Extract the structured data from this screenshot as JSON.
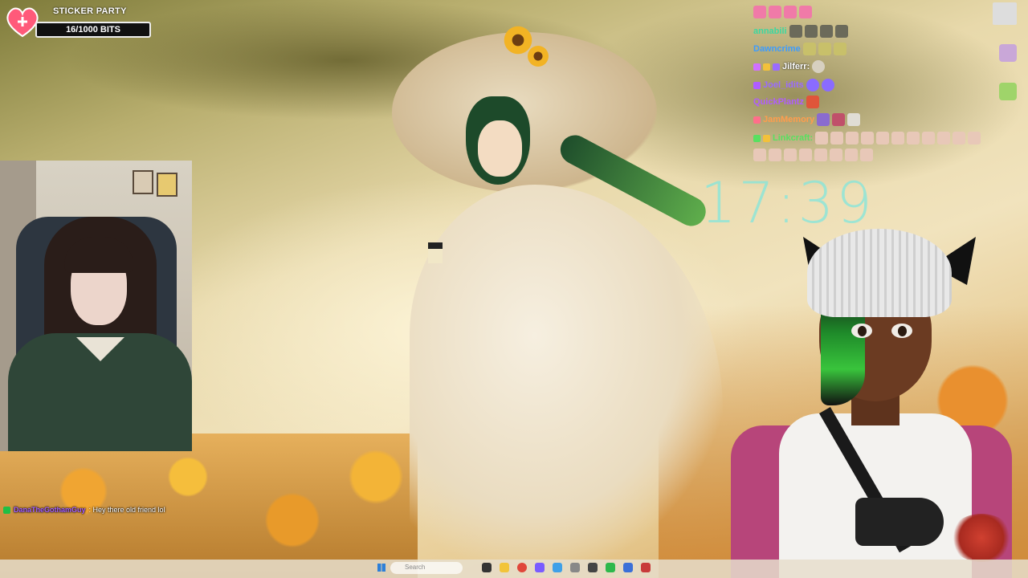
{
  "sticker_party": {
    "title": "STICKER PARTY",
    "bits": "16/1000 BITS",
    "progress_fraction": 0.016
  },
  "chat_overlay": [
    {
      "name": "",
      "color": "#ff6fb0"
    },
    {
      "name": "annabili",
      "color": "#3cd8a0"
    },
    {
      "name": "Dawncrime",
      "color": "#3c9cff"
    },
    {
      "name": "Jilferr:",
      "color": "#d070ff"
    },
    {
      "name": "Joel_idits",
      "color": "#9a6bff"
    },
    {
      "name": "QuickPlantz",
      "color": "#b05cff"
    },
    {
      "name": "JamMemory",
      "color": "#ff9d4d"
    },
    {
      "name": "Linkcraft:",
      "color": "#58e060"
    }
  ],
  "clock": {
    "time": "17:39",
    "sub1": "",
    "sub2": ""
  },
  "chat_line": {
    "username": "DanaTheGothamGuy",
    "message": ": Hey there old friend lol"
  },
  "taskbar": {
    "search_placeholder": "Search",
    "weather": ""
  },
  "colors": {
    "clock": "#82e6dc",
    "jacket": "#b7457a",
    "vt_hair_accent": "#39c43c",
    "taskbar_bg": "#e6decd",
    "start_blue": "#2d7fd8"
  }
}
